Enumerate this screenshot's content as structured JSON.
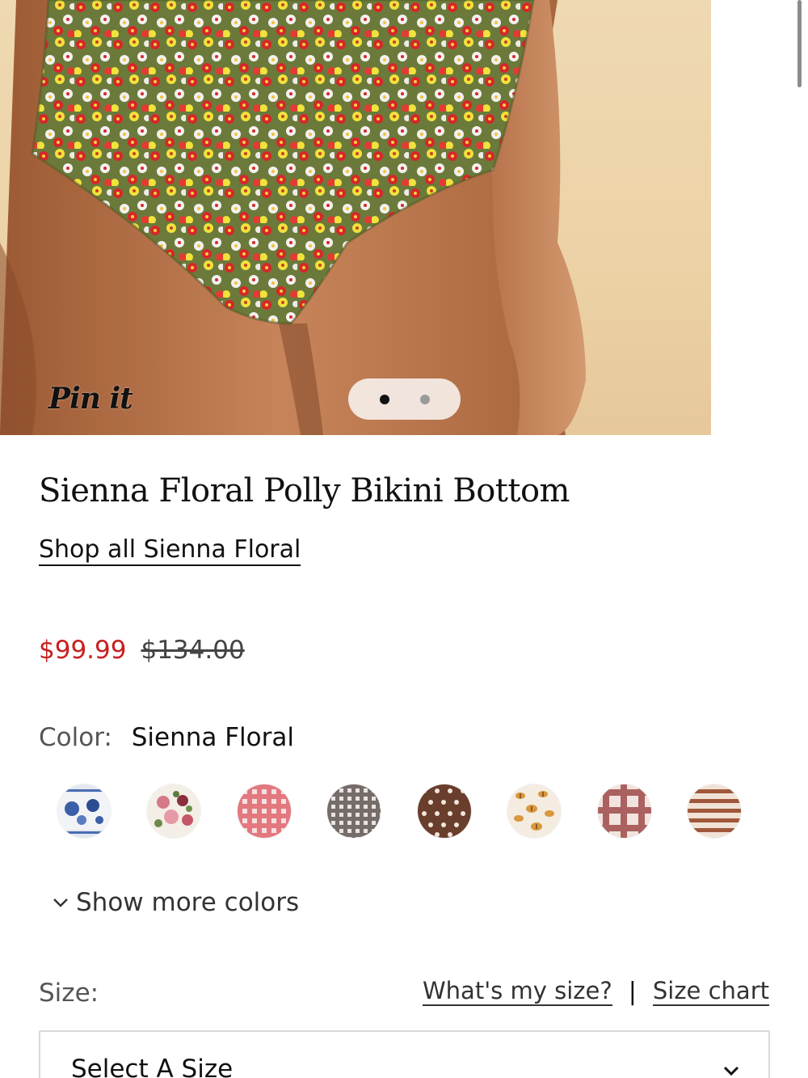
{
  "hero": {
    "pin_label": "Pin it",
    "carousel_total": 2,
    "carousel_active": 1
  },
  "product": {
    "title": "Sienna Floral Polly Bikini Bottom",
    "shop_all_link": "Shop all Sienna Floral",
    "price_sale": "$99.99",
    "price_original": "$134.00"
  },
  "color": {
    "label": "Color:",
    "value": "Sienna Floral",
    "swatches": [
      "blue-floral-toile",
      "pink-rose-floral",
      "red-gingham",
      "black-gingham",
      "brown-polka-dot",
      "butterfly-print",
      "red-plaid",
      "brown-stripe"
    ],
    "show_more_label": "Show more colors"
  },
  "size": {
    "label": "Size:",
    "whats_my_size": "What's my size?",
    "separator": "|",
    "size_chart": "Size chart",
    "select_placeholder": "Select A Size"
  },
  "colors": {
    "sale_red": "#c8201e",
    "text": "#111111",
    "muted": "#555555"
  }
}
